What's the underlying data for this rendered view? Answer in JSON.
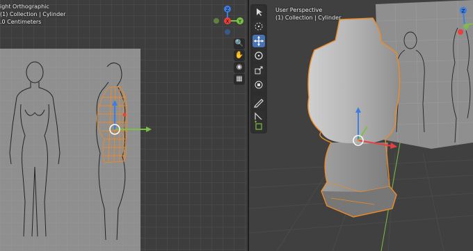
{
  "left_viewport": {
    "info_lines": [
      "ight Orthographic",
      "(1) Collection | Cylinder",
      ".0 Centimeters"
    ],
    "gizmo_axes": {
      "z": "Z",
      "y": "Y",
      "x": "X"
    },
    "nav_icons": [
      "zoom-icon",
      "hand-pan-icon",
      "camera-icon",
      "grid-icon"
    ]
  },
  "right_viewport": {
    "info_lines": [
      "User Perspective",
      "(1) Collection | Cylinder"
    ],
    "gizmo_axes": {
      "z": "Z",
      "y": "Y"
    }
  },
  "toolbar": {
    "tools": [
      "select-box-tool",
      "cursor-tool",
      "move-tool",
      "rotate-tool",
      "scale-tool",
      "transform-tool",
      "annotate-tool",
      "measure-tool",
      "add-cube-tool"
    ],
    "active_tool": "move-tool"
  },
  "colors": {
    "selection": "#f08a24",
    "x_axis": "#e8403f",
    "y_axis": "#7ac143",
    "z_axis": "#3d7ee0",
    "active_tool": "#4772b3",
    "reference_sheet": "#8f8f8f"
  }
}
